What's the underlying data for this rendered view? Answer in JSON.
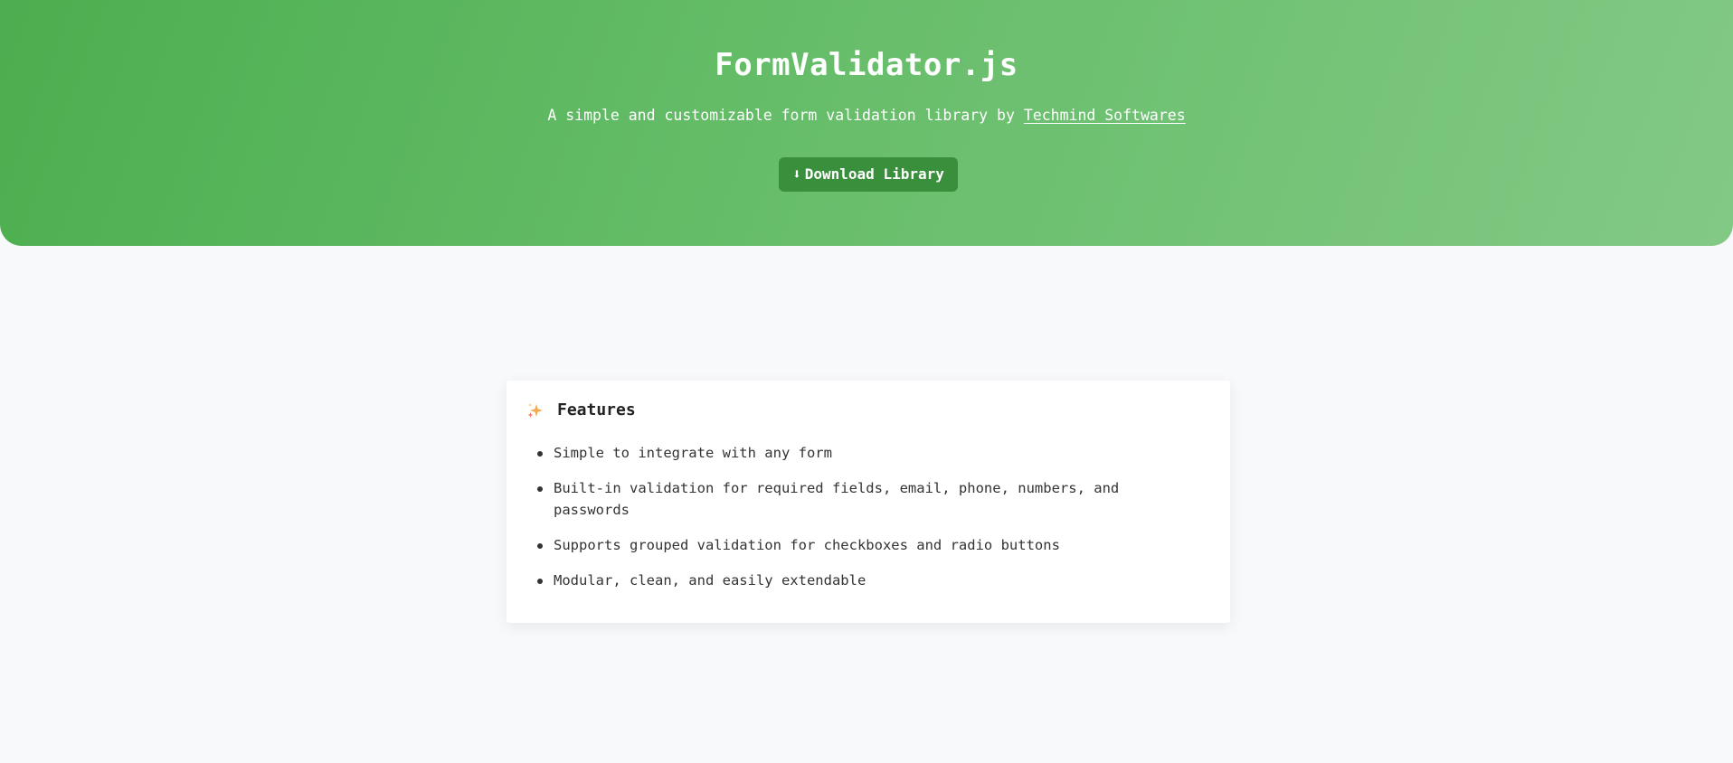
{
  "hero": {
    "title": "FormValidator.js",
    "subtitle_prefix": "A simple and customizable form validation library by ",
    "subtitle_link": "Techmind Softwares",
    "download_icon": "⬇",
    "download_label": "Download Library",
    "colors": {
      "gradient_start": "#4cae4f",
      "gradient_end": "#82c985",
      "button": "#3a8f3d"
    }
  },
  "features": {
    "icon": "sparkle-icon",
    "title": "Features",
    "items": [
      "Simple to integrate with any form",
      "Built-in validation for required fields, email, phone, numbers, and passwords",
      "Supports grouped validation for checkboxes and radio buttons",
      "Modular, clean, and easily extendable"
    ]
  }
}
